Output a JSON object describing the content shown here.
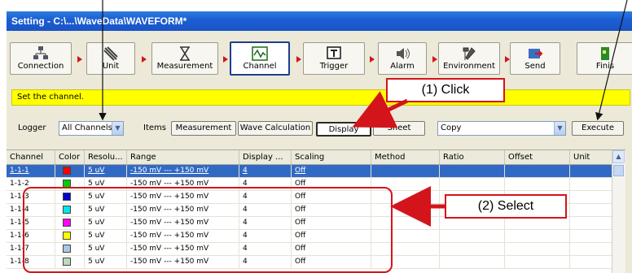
{
  "window": {
    "title": "Setting - C:\\...\\WaveData\\WAVEFORM*"
  },
  "toolbar": {
    "items": [
      {
        "label": "Connection",
        "icon": "network-icon"
      },
      {
        "label": "Unit",
        "icon": "unit-icon"
      },
      {
        "label": "Measurement",
        "icon": "hourglass-icon"
      },
      {
        "label": "Channel",
        "icon": "waveform-icon",
        "selected": true
      },
      {
        "label": "Trigger",
        "icon": "trigger-icon"
      },
      {
        "label": "Alarm",
        "icon": "speaker-icon"
      },
      {
        "label": "Environment",
        "icon": "tools-icon"
      },
      {
        "label": "Send",
        "icon": "send-icon"
      },
      {
        "label": "Finis",
        "icon": "finish-icon"
      }
    ]
  },
  "hint": {
    "text": "Set the channel."
  },
  "controls": {
    "logger_label": "Logger",
    "logger_value": "All Channels",
    "items_label": "Items",
    "tabs": [
      "Measurement",
      "Wave Calculation",
      "Display",
      "Sheet"
    ],
    "action_value": "Copy",
    "execute_label": "Execute"
  },
  "table": {
    "columns": [
      "Channel",
      "Color",
      "Resolu...",
      "Range",
      "Display ...",
      "Scaling",
      "Method",
      "Ratio",
      "Offset",
      "Unit"
    ],
    "rows": [
      {
        "channel": "1-1-1",
        "color": "#ff0000",
        "resolution": "5 uV",
        "range": "-150 mV  ---  +150 mV",
        "display": "4",
        "scaling": "Off"
      },
      {
        "channel": "1-1-2",
        "color": "#00cc00",
        "resolution": "5 uV",
        "range": "-150 mV  ---  +150 mV",
        "display": "4",
        "scaling": "Off"
      },
      {
        "channel": "1-1-3",
        "color": "#0000cc",
        "resolution": "5 uV",
        "range": "-150 mV  ---  +150 mV",
        "display": "4",
        "scaling": "Off"
      },
      {
        "channel": "1-1-4",
        "color": "#00e5e5",
        "resolution": "5 uV",
        "range": "-150 mV  ---  +150 mV",
        "display": "4",
        "scaling": "Off"
      },
      {
        "channel": "1-1-5",
        "color": "#ff00ff",
        "resolution": "5 uV",
        "range": "-150 mV  ---  +150 mV",
        "display": "4",
        "scaling": "Off"
      },
      {
        "channel": "1-1-6",
        "color": "#ffff00",
        "resolution": "5 uV",
        "range": "-150 mV  ---  +150 mV",
        "display": "4",
        "scaling": "Off"
      },
      {
        "channel": "1-1-7",
        "color": "#a9c6e8",
        "resolution": "5 uV",
        "range": "-150 mV  ---  +150 mV",
        "display": "4",
        "scaling": "Off"
      },
      {
        "channel": "1-1-8",
        "color": "#c0d8c0",
        "resolution": "5 uV",
        "range": "-150 mV  ---  +150 mV",
        "display": "4",
        "scaling": "Off"
      }
    ]
  },
  "callouts": {
    "click": "(1) Click",
    "select": "(2) Select"
  },
  "colors": {
    "accent": "#d4141b",
    "hint_bg": "#ffff00",
    "selection": "#316ac5",
    "title_bar": "#1c5fd3"
  }
}
